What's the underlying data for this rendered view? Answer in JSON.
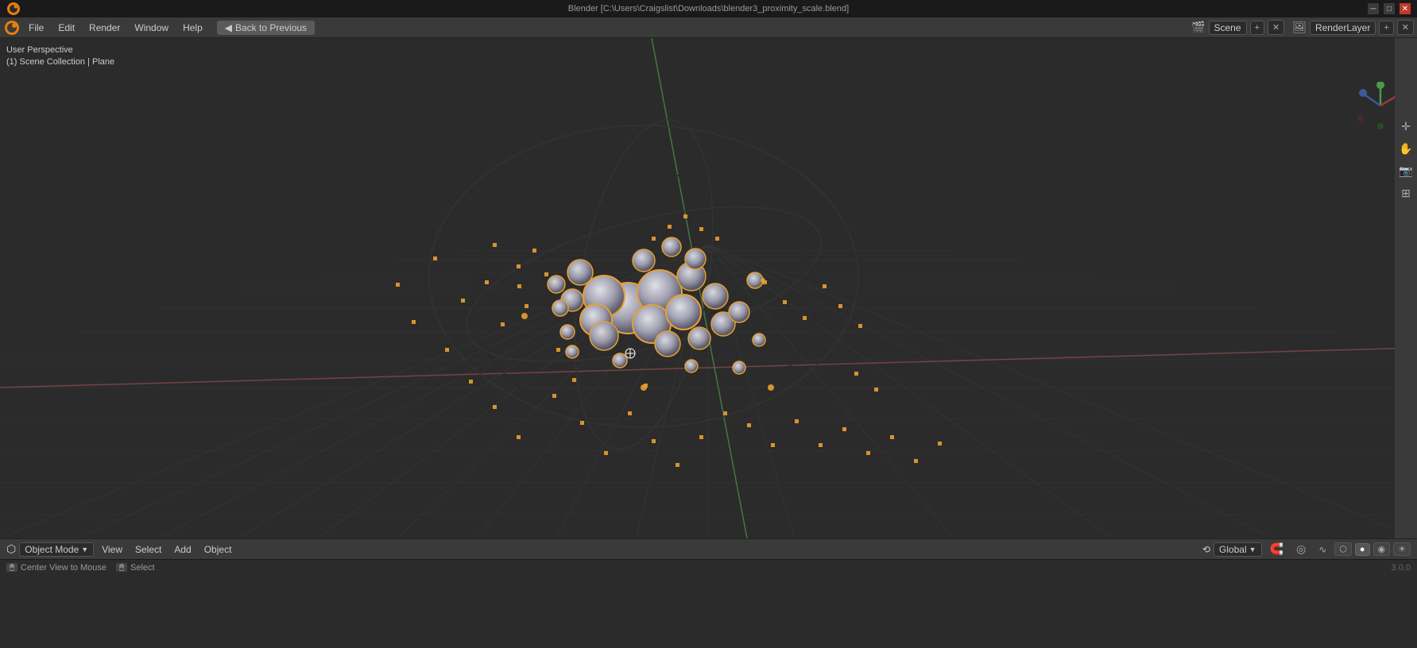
{
  "titlebar": {
    "title": "Blender [C:\\Users\\Craigslist\\Downloads\\blender3_proximity_scale.blend]",
    "controls": [
      "minimize",
      "maximize",
      "close"
    ]
  },
  "menubar": {
    "items": [
      "File",
      "Edit",
      "Render",
      "Window",
      "Help"
    ],
    "back_button": "Back to Previous",
    "scene_label": "Scene",
    "renderlayer_label": "RenderLayer"
  },
  "viewport": {
    "view_perspective": "User Perspective",
    "scene_collection": "(1) Scene Collection | Plane"
  },
  "right_toolbar": {
    "icons": [
      "cursor",
      "hand",
      "camera",
      "grid"
    ]
  },
  "bottom_bar": {
    "mode": "Object Mode",
    "menus": [
      "View",
      "Select",
      "Add",
      "Object"
    ],
    "transform": "Global",
    "snap_icon": "magnet",
    "proportional_icon": "circle"
  },
  "statusbar": {
    "mouse_label": "Center View to Mouse",
    "select_label": "Select",
    "version": "3.0.0"
  }
}
